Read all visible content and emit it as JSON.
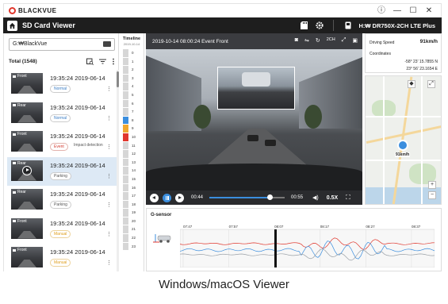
{
  "app": {
    "brand": "BLACKVUE",
    "title": "SD Card Viewer",
    "device": "H:₩ DR750X-2CH LTE Plus",
    "window_buttons": [
      "ⓘ",
      "—",
      "☐",
      "✕"
    ]
  },
  "sidebar": {
    "folder": "G:₩BlackVue",
    "total_label": "Total (1548)",
    "items": [
      {
        "camera": "Front",
        "time": "19:35:24",
        "date": "2019-06-14",
        "tag": "Normal",
        "tag_class": "normal",
        "extra": ""
      },
      {
        "camera": "Rear",
        "time": "19:35:24",
        "date": "2019-06-14",
        "tag": "Normal",
        "tag_class": "normal",
        "extra": ""
      },
      {
        "camera": "Front",
        "time": "19:35:24",
        "date": "2019-06-14",
        "tag": "Event",
        "tag_class": "event",
        "extra": "Impact detection"
      },
      {
        "camera": "Rear",
        "time": "19:35:24",
        "date": "2019-06-14",
        "tag": "Parking",
        "tag_class": "parking",
        "extra": "",
        "selected": true
      },
      {
        "camera": "Rear",
        "time": "19:35:24",
        "date": "2019-06-14",
        "tag": "Parking",
        "tag_class": "parking",
        "extra": ""
      },
      {
        "camera": "Front",
        "time": "19:35:24",
        "date": "2019-06-14",
        "tag": "Manual",
        "tag_class": "manual",
        "extra": ""
      },
      {
        "camera": "Front",
        "time": "19:35:24",
        "date": "2019-06-14",
        "tag": "Manual",
        "tag_class": "manual",
        "extra": ""
      }
    ]
  },
  "timeline": {
    "title": "Timeline",
    "date": "2019-10-14",
    "hours": [
      "0",
      "1",
      "2",
      "3",
      "4",
      "5",
      "6",
      "7",
      "8",
      "9",
      "10",
      "11",
      "12",
      "13",
      "14",
      "15",
      "16",
      "17",
      "18",
      "19",
      "20",
      "21",
      "22",
      "23"
    ],
    "colors": {
      "normal": "#3b8ede",
      "event": "#e0362c",
      "parking": "#9aa0a6",
      "manual": "#f0a830",
      "empty": "#d6d6d6"
    },
    "cell_types": [
      "empty",
      "empty",
      "empty",
      "empty",
      "empty",
      "empty",
      "empty",
      "empty",
      "normal",
      "manual",
      "event",
      "empty",
      "empty",
      "empty",
      "empty",
      "empty",
      "empty",
      "empty",
      "empty",
      "empty",
      "empty",
      "empty",
      "empty",
      "empty"
    ]
  },
  "video": {
    "header": "2019-10-14 08:00:24 Event Front",
    "mode": "2CH",
    "time_current": "00:44",
    "time_total": "00:55",
    "progress": 0.8,
    "speed": "0.5X"
  },
  "info": {
    "speed_label": "Driving Speed",
    "speed_value": "91km/h",
    "coord_label": "Coordinates",
    "lat": "-58° 23'  15.7855 N",
    "lon": "23° 56'  23.1654 E"
  },
  "map": {
    "pin_label": "91km/h",
    "zoom_in": "+",
    "zoom_out": "−"
  },
  "gsensor": {
    "title": "G-sensor",
    "times": [
      "07:47",
      "07:57",
      "08:07",
      "08:17",
      "08:27",
      "08:37"
    ]
  },
  "caption": "Windows/macOS Viewer"
}
